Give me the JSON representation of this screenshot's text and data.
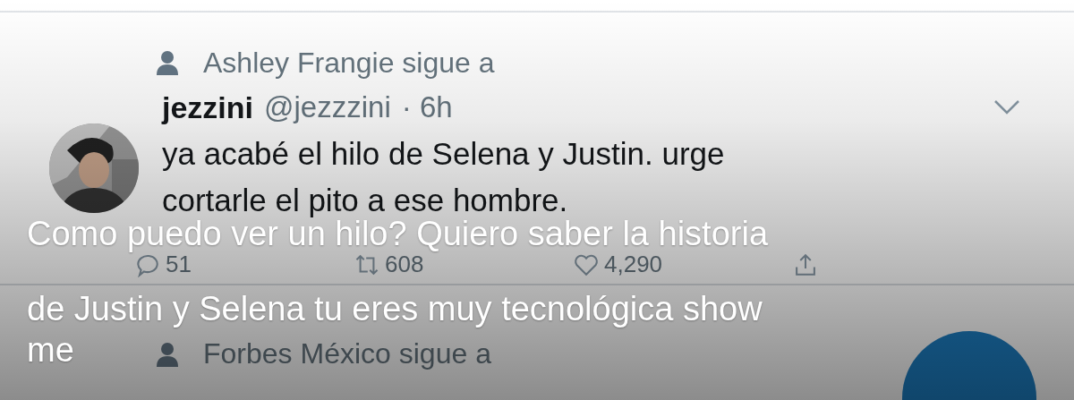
{
  "tweet": {
    "social_context": "Ashley Frangie sigue a",
    "avatar": {
      "kind": "picture"
    },
    "name": "jezzini",
    "handle": "@jezzzini",
    "time": "· 6h",
    "text_lines": [
      "ya acabé el hilo de Selena y Justin. urge",
      "cortarle el pito a ese hombre."
    ],
    "actions": [
      {
        "kind": "reply",
        "count": "51"
      },
      {
        "kind": "retweet",
        "count": "608"
      },
      {
        "kind": "like",
        "count": "4,290"
      },
      {
        "kind": "share"
      }
    ]
  },
  "next_tweet": {
    "social_context": "Forbes México sigue a"
  },
  "caption_lines": [
    "Como puedo ver un hilo? Quiero saber la historia",
    "de Justin y Selena tu eres muy tecnológica show",
    "me"
  ]
}
